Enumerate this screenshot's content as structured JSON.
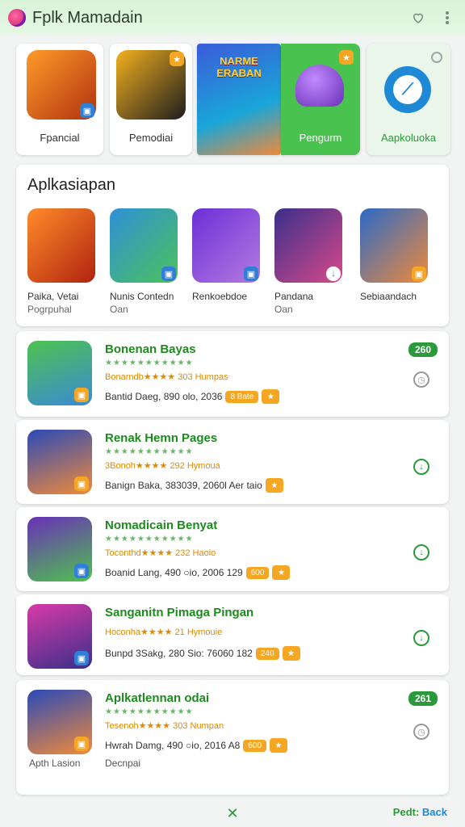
{
  "app": {
    "title": "Fplk Mamadain"
  },
  "topbar": {
    "icons": [
      "heart-outline-icon",
      "more-vert-icon"
    ]
  },
  "featured": [
    {
      "label": "Fpancial",
      "icon_colors": [
        "#ff7a1a",
        "#6b2a10"
      ]
    },
    {
      "label": "Pemodiai",
      "icon_colors": [
        "#f2b01e",
        "#1d1d1d"
      ]
    },
    {
      "label": "NARME ERABAN",
      "icon_colors": [
        "#3b5bd9",
        "#19a6d8"
      ]
    },
    {
      "label": "Pengurm",
      "icon_colors": [
        "#49c24f",
        "#8a3be0"
      ]
    },
    {
      "label": "Aapkoluoka",
      "icon_colors": [
        "#eaf6ea",
        "#1e8ad6"
      ]
    }
  ],
  "section": {
    "title": "Aplkasiapan",
    "tiles": [
      {
        "name": "Paika, Vetai",
        "sub": "Pogrpuhal",
        "colors": [
          "#d23c10",
          "#ff8b2a"
        ]
      },
      {
        "name": "Nunis Contedn",
        "sub": "Oan",
        "colors": [
          "#2f90d8",
          "#4bc25a"
        ]
      },
      {
        "name": "Renkoebdoe",
        "sub": "",
        "colors": [
          "#6b2fd8",
          "#b57ae0"
        ]
      },
      {
        "name": "Pandana",
        "sub": "Oan",
        "colors": [
          "#3a2f8a",
          "#d84a8a"
        ]
      },
      {
        "name": "Sebiaandach",
        "sub": "",
        "colors": [
          "#2a6ac8",
          "#f08a3a"
        ]
      }
    ]
  },
  "list": [
    {
      "title": "Bonenan Bayas",
      "stars": "★★★★★★★★★★★",
      "rating": "Bonarndb★★★★ 303 Humpas",
      "meta": "Bantid Daeg, 890 olo, 2036",
      "pill": "8 Bate",
      "tag": "260",
      "side": "clock-icon",
      "footLeft": "",
      "footRight": "",
      "colors": [
        "#4fc24f",
        "#3a8ad6"
      ]
    },
    {
      "title": "Renak Hemn Pages",
      "stars": "★★★★★★★★★★★",
      "rating": "3Bonoh★★★★ 292 Hymoua",
      "meta": "Banign Baka, 383039, 2060l Aer taio",
      "pill": "",
      "tag": "",
      "side": "download-icon",
      "footLeft": "",
      "footRight": "",
      "colors": [
        "#2a4ab8",
        "#f08a3a"
      ]
    },
    {
      "title": "Nomadicain Benyat",
      "stars": "★★★★★★★★★★★",
      "rating": "Toconthd★★★★ 232 Haoio",
      "meta": "Boanid Lang, 490 ○io, 2006 129",
      "pill": "600",
      "tag": "",
      "side": "download-icon",
      "footLeft": "",
      "footRight": "",
      "colors": [
        "#6a2fb8",
        "#4fc24f"
      ]
    },
    {
      "title": "Sanganitn Pimaga Pingan",
      "stars": "",
      "rating": "Hoconha★★★★ 21 Hymouie",
      "meta": "Bunpd 3Sakg, 280 Sio: 76060 182",
      "pill": "240",
      "tag": "",
      "side": "download-icon",
      "footLeft": "",
      "footRight": "",
      "colors": [
        "#d83aa8",
        "#3a2f8a"
      ]
    },
    {
      "title": "Aplkatlennan odai",
      "stars": "★★★★★★★★★★★",
      "rating": "Tesenoh★★★★ 303 Numpan",
      "meta": "Hwrah Damg, 490 ○io, 2016 A8",
      "pill": "600",
      "tag": "261",
      "side": "clock-icon",
      "footLeft": "Apth Lasion",
      "footRight": "Decnpai",
      "colors": [
        "#2a4ab8",
        "#f08a3a"
      ]
    }
  ],
  "bottom": {
    "link_a": "Pedt:",
    "link_b": "Back"
  },
  "colors": {
    "accent": "#2a9a3a",
    "rating": "#e08a00",
    "pill": "#f5a623"
  }
}
